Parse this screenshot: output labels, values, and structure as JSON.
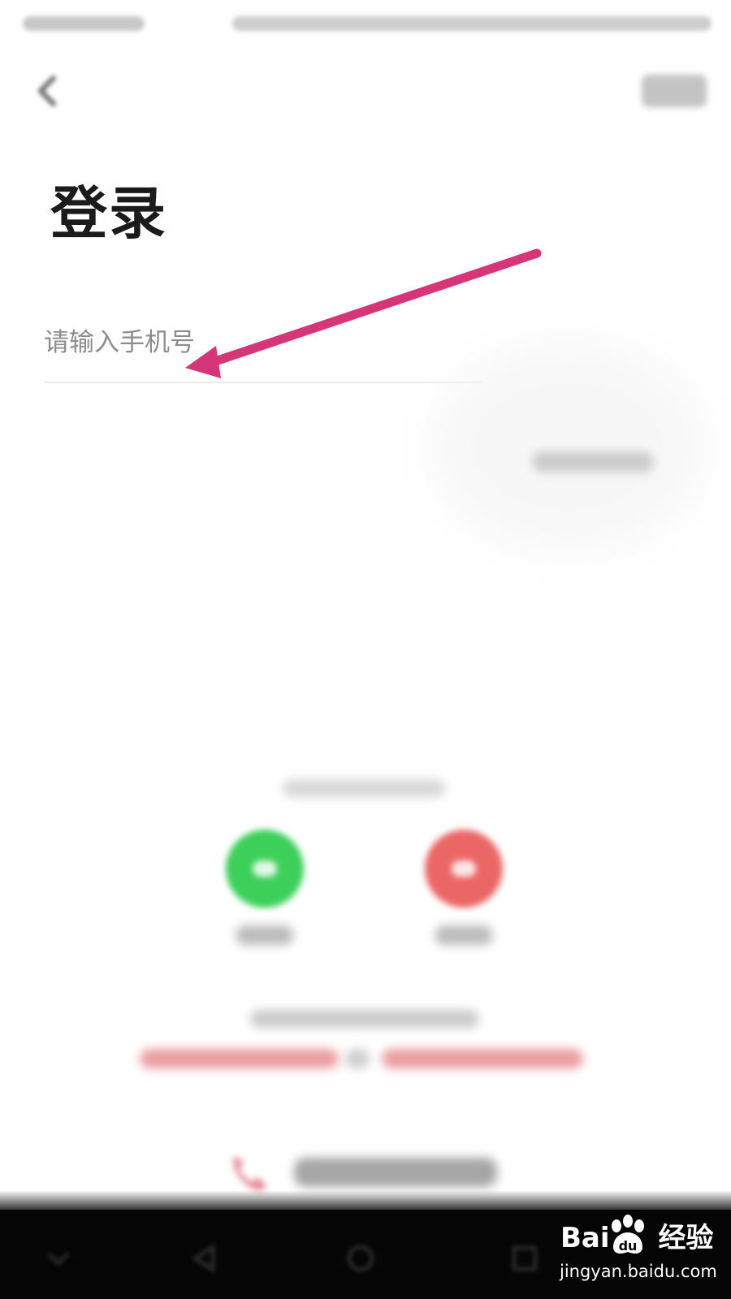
{
  "page": {
    "title": "登录"
  },
  "phone_input": {
    "placeholder": "请输入手机号",
    "value": ""
  },
  "colors": {
    "arrow": "#d63577",
    "wechat": "#3ccf5a",
    "weibo": "#ea6766",
    "agreement_link": "#dc5b62"
  },
  "icons": {
    "back": "chevron-left-icon",
    "help": "phone-icon",
    "wechat": "wechat-icon",
    "weibo": "weibo-icon"
  },
  "watermark": {
    "brand_prefix": "Bai",
    "brand_suffix": "经验",
    "url": "jingyan.baidu.com"
  }
}
